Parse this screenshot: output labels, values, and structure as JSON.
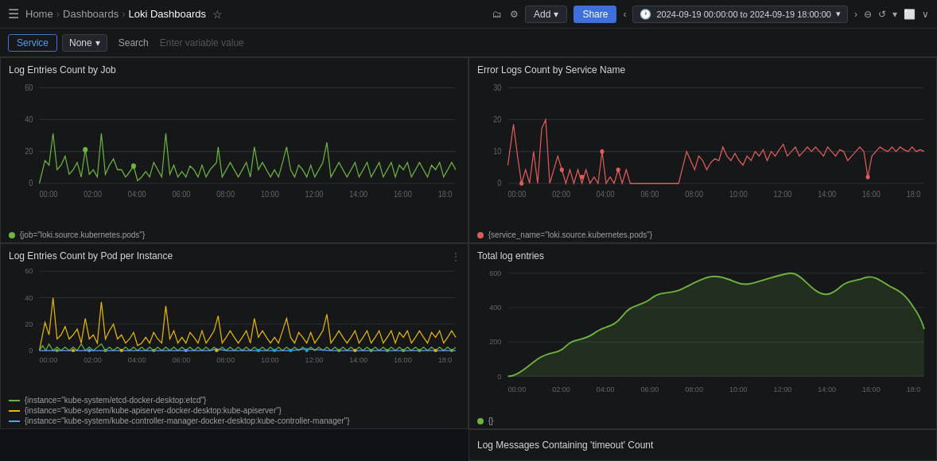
{
  "topbar": {
    "menu_icon": "☰",
    "breadcrumb": [
      {
        "label": "Home",
        "active": false
      },
      {
        "label": "Dashboards",
        "active": false
      },
      {
        "label": "Loki Dashboards",
        "active": true
      }
    ],
    "star_icon": "☆",
    "add_label": "Add",
    "share_label": "Share",
    "nav_left": "‹",
    "nav_right": "›",
    "time_range": "2024-09-19 00:00:00 to 2024-09-19 18:00:00",
    "zoom_icon": "⊖",
    "refresh_icon": "↺",
    "tv_icon": "⬜",
    "chevron_icon": "∨"
  },
  "filterbar": {
    "service_label": "Service",
    "none_label": "None",
    "none_chevron": "▾",
    "search_label": "Search",
    "search_placeholder": "Enter variable value"
  },
  "panels": {
    "top_left": {
      "title": "Log Entries Count by Job",
      "legend": "{job=\"loki.source.kubernetes.pods\"}",
      "legend_color": "#6db33f",
      "y_max": 60,
      "y_ticks": [
        0,
        20,
        40,
        60
      ],
      "x_ticks": [
        "00:00",
        "02:00",
        "04:00",
        "06:00",
        "08:00",
        "10:00",
        "12:00",
        "14:00",
        "16:00",
        "18:0"
      ]
    },
    "top_right": {
      "title": "Error Logs Count by Service Name",
      "legend": "{service_name=\"loki.source.kubernetes.pods\"}",
      "legend_color": "#e05b5b",
      "y_max": 30,
      "y_ticks": [
        0,
        10,
        20,
        30
      ],
      "x_ticks": [
        "00:00",
        "02:00",
        "04:00",
        "06:00",
        "08:00",
        "10:00",
        "12:00",
        "14:00",
        "16:00",
        "18:0"
      ]
    },
    "bottom_left": {
      "title": "Log Entries Count by Pod per Instance",
      "menu_icon": "⋮",
      "legends": [
        {
          "color": "#6db33f",
          "label": "{instance=\"kube-system/etcd-docker-desktop:etcd\"}"
        },
        {
          "color": "#e6b800",
          "label": "{instance=\"kube-system/kube-apiserver-docker-desktop:kube-apiserver\"}"
        },
        {
          "color": "#5b9cf6",
          "label": "{instance=\"kube-system/kube-controller-manager-docker-desktop:kube-controller-manager\"}"
        }
      ],
      "y_max": 60,
      "y_ticks": [
        0,
        20,
        40,
        60
      ],
      "x_ticks": [
        "00:00",
        "02:00",
        "04:00",
        "06:00",
        "08:00",
        "10:00",
        "12:00",
        "14:00",
        "16:00",
        "18:0"
      ]
    },
    "bottom_right": {
      "title": "Total log entries",
      "legend": "{}",
      "legend_color": "#6db33f",
      "y_max": 600,
      "y_ticks": [
        0,
        200,
        400,
        600
      ],
      "x_ticks": [
        "00:00",
        "02:00",
        "04:00",
        "06:00",
        "08:00",
        "10:00",
        "12:00",
        "14:00",
        "16:00",
        "18:0"
      ]
    },
    "bottom_right2": {
      "title": "Log Messages Containing 'timeout' Count"
    }
  }
}
